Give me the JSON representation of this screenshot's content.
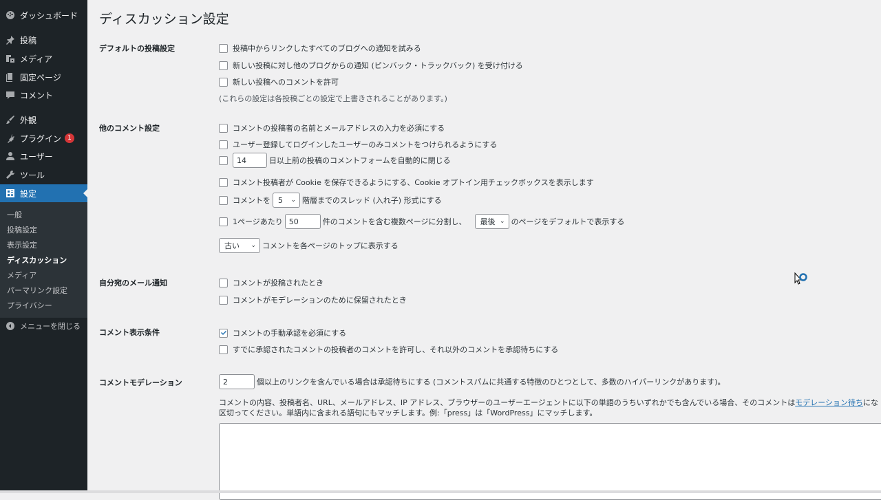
{
  "sidebar": {
    "items": [
      {
        "label": "ダッシュボード",
        "icon": "dashboard-icon"
      },
      {
        "label": "投稿",
        "icon": "pin-icon"
      },
      {
        "label": "メディア",
        "icon": "media-icon"
      },
      {
        "label": "固定ページ",
        "icon": "page-icon"
      },
      {
        "label": "コメント",
        "icon": "comment-icon"
      },
      {
        "label": "外観",
        "icon": "brush-icon"
      },
      {
        "label": "プラグイン",
        "icon": "plugin-icon",
        "badge": "1"
      },
      {
        "label": "ユーザー",
        "icon": "user-icon"
      },
      {
        "label": "ツール",
        "icon": "wrench-icon"
      },
      {
        "label": "設定",
        "icon": "settings-icon"
      }
    ],
    "submenu": [
      "一般",
      "投稿設定",
      "表示設定",
      "ディスカッション",
      "メディア",
      "パーマリンク設定",
      "プライバシー"
    ],
    "collapse_label": "メニューを閉じる"
  },
  "page": {
    "title": "ディスカッション設定",
    "sections": {
      "default_post": {
        "label": "デフォルトの投稿設定",
        "opt1": "投稿中からリンクしたすべてのブログへの通知を試みる",
        "opt2": "新しい投稿に対し他のブログからの通知 (ピンバック・トラックバック) を受け付ける",
        "opt3": "新しい投稿へのコメントを許可",
        "note": "(これらの設定は各投稿ごとの設定で上書きされることがあります。)"
      },
      "other_comment": {
        "label": "他のコメント設定",
        "opt1": "コメントの投稿者の名前とメールアドレスの入力を必須にする",
        "opt2": "ユーザー登録してログインしたユーザーのみコメントをつけられるようにする",
        "close_days_value": "14",
        "opt3_suffix": "日以上前の投稿のコメントフォームを自動的に閉じる",
        "opt4": "コメント投稿者が Cookie を保存できるようにする、Cookie オプトイン用チェックボックスを表示します",
        "opt5_prefix": "コメントを",
        "thread_depth": "5",
        "opt5_suffix": "階層までのスレッド (入れ子) 形式にする",
        "opt6_prefix": "1ページあたり",
        "per_page_value": "50",
        "opt6_mid": "件のコメントを含む複数ページに分割し、",
        "default_page": "最後",
        "opt6_suffix": "のページをデフォルトで表示する",
        "order_value": "古い",
        "order_suffix": "コメントを各ページのトップに表示する"
      },
      "email_me": {
        "label": "自分宛のメール通知",
        "opt1": "コメントが投稿されたとき",
        "opt2": "コメントがモデレーションのために保留されたとき"
      },
      "before_appear": {
        "label": "コメント表示条件",
        "opt1": "コメントの手動承認を必須にする",
        "opt2": "すでに承認されたコメントの投稿者のコメントを許可し、それ以外のコメントを承認待ちにする"
      },
      "moderation": {
        "label": "コメントモデレーション",
        "links_value": "2",
        "links_suffix": "個以上のリンクを含んでいる場合は承認待ちにする (コメントスパムに共通する特徴のひとつとして、多数のハイパーリンクがあります)。",
        "desc1": "コメントの内容、投稿者名、URL、メールアドレス、IP アドレス、ブラウザーのユーザーエージェントに以下の単語のうちいずれかでも含んでいる場合、そのコメントは",
        "desc_link": "モデレーション待ち",
        "desc1_tail": "にな",
        "desc2": "区切ってください。単語内に含まれる語句にもマッチします。例:「press」は「WordPress」にマッチします。"
      }
    }
  },
  "colors": {
    "sidebar_bg": "#1d2327",
    "accent": "#2271b1",
    "badge": "#d63638"
  }
}
